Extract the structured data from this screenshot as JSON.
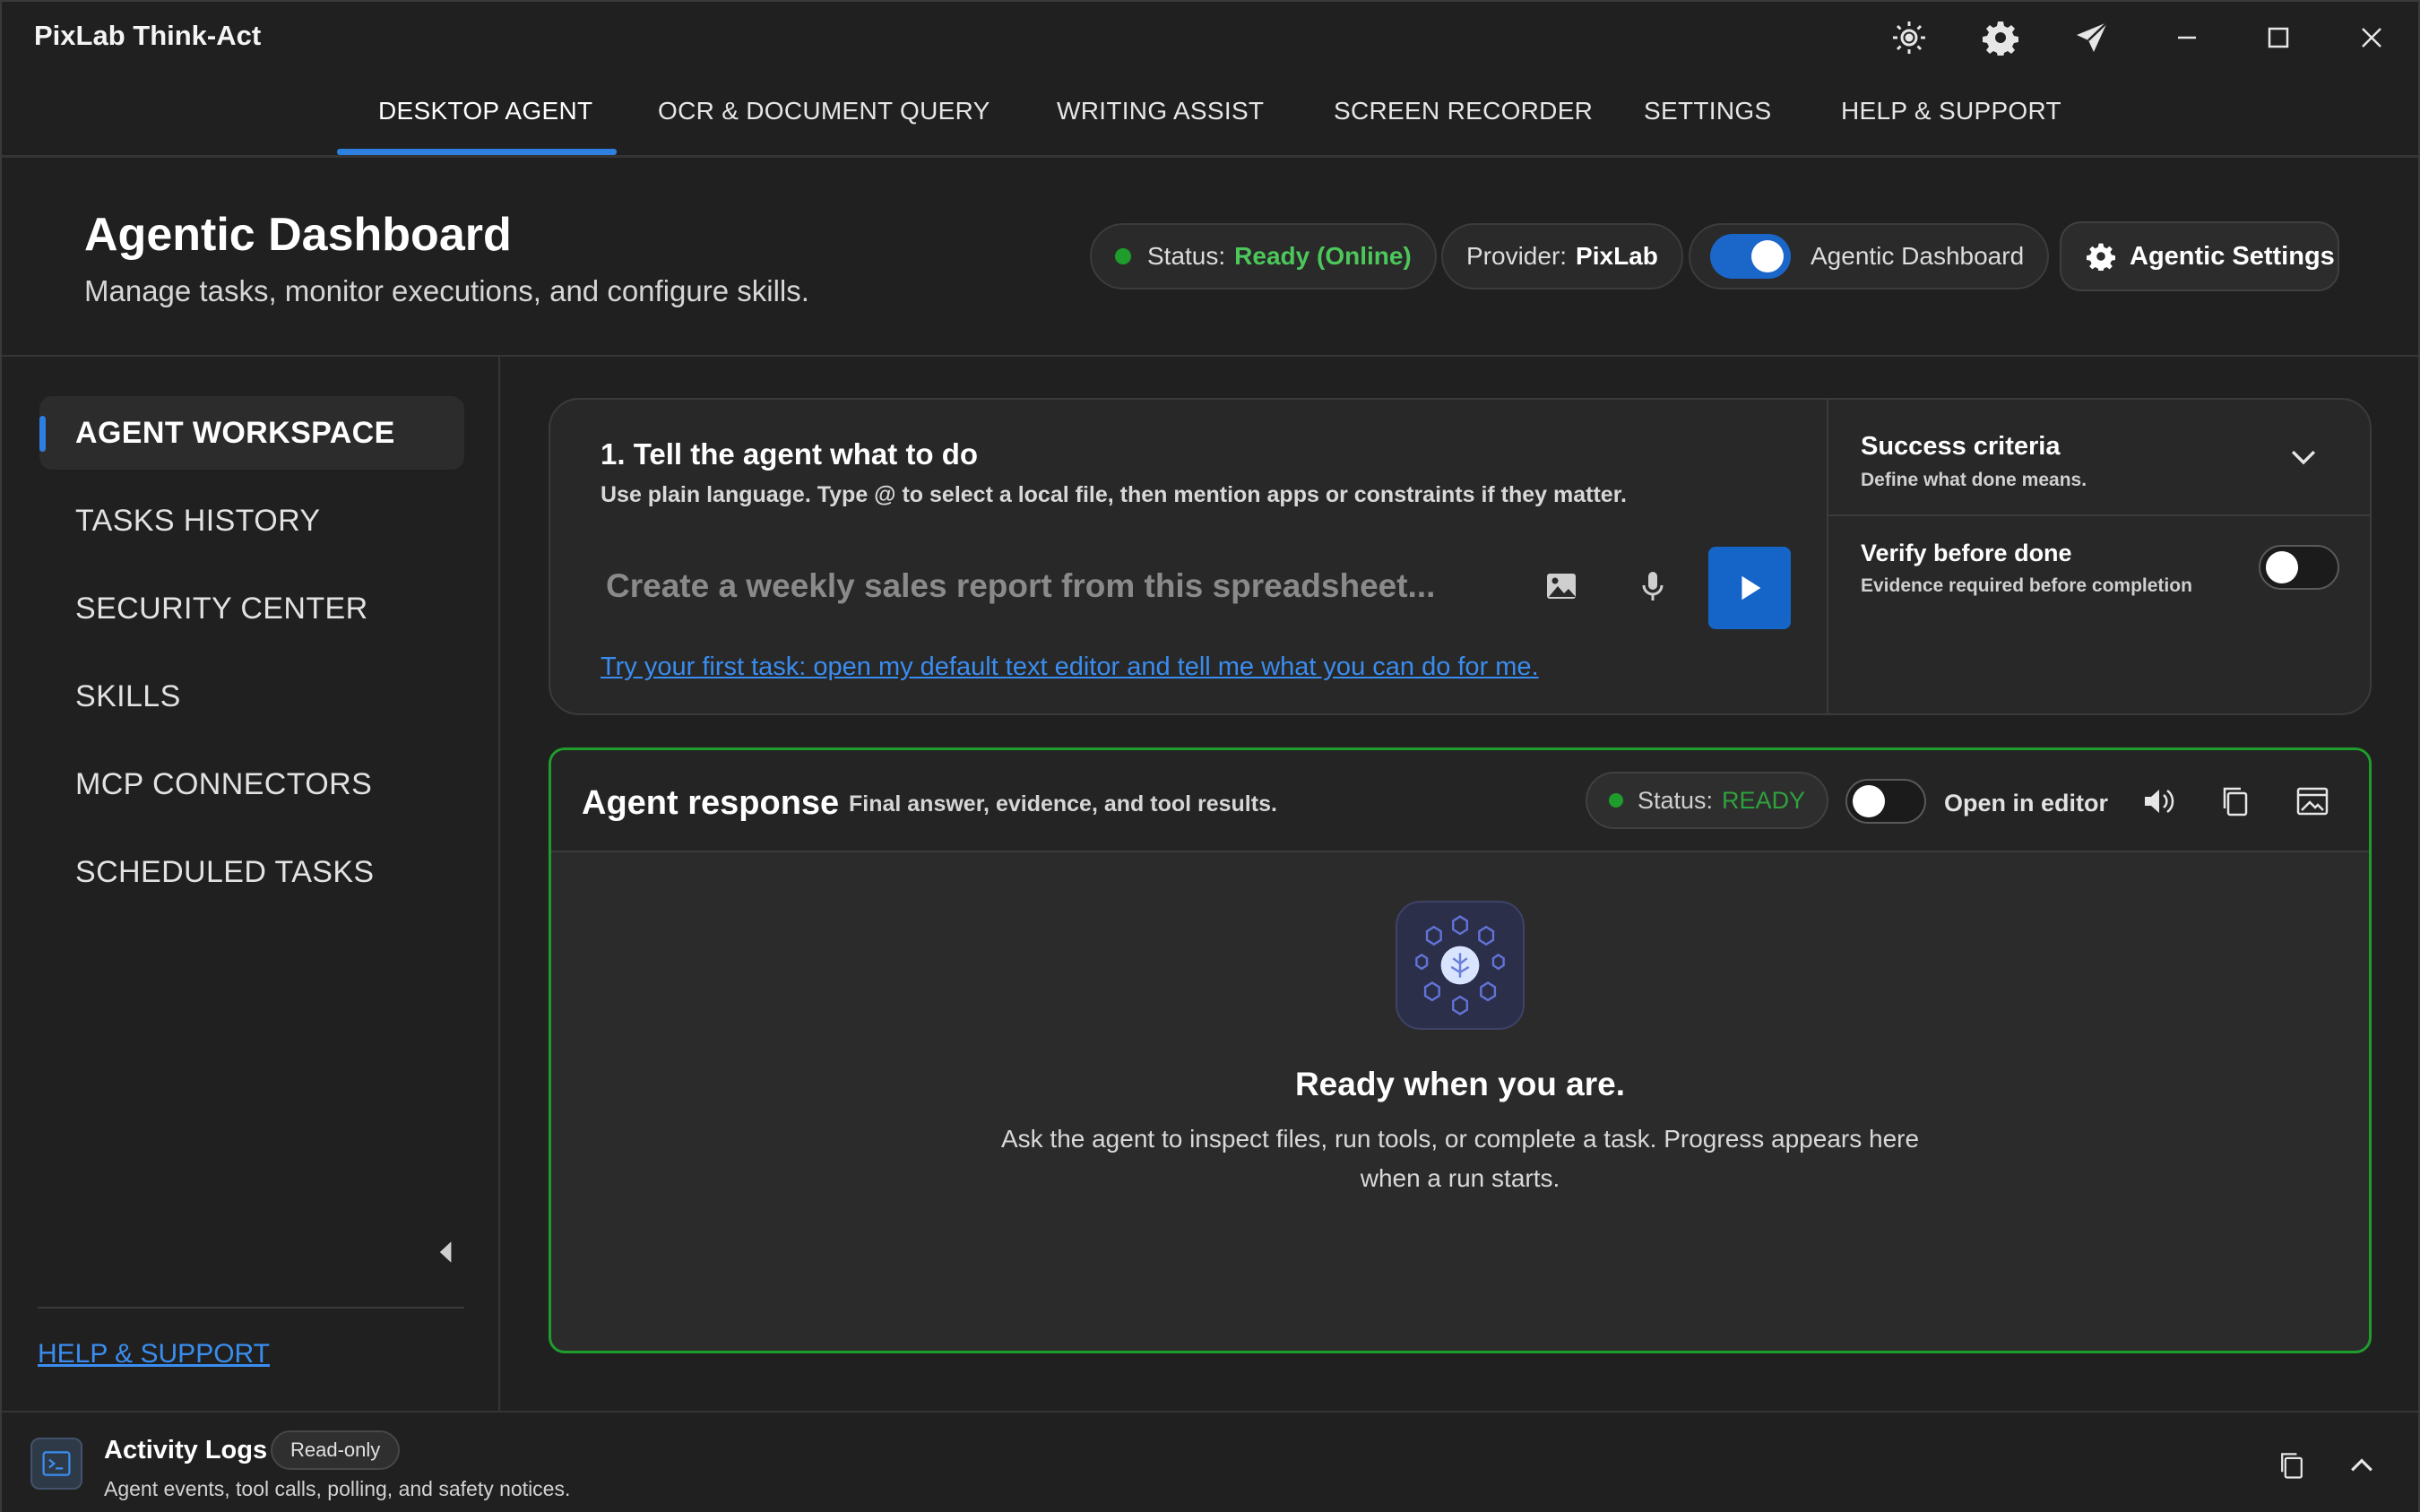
{
  "app": {
    "title": "PixLab Think-Act"
  },
  "titlebar": {
    "icons": [
      "theme-icon",
      "gear-icon",
      "send-icon",
      "minimize-icon",
      "maximize-icon",
      "close-icon"
    ]
  },
  "nav": {
    "tabs": [
      {
        "label": "DESKTOP AGENT",
        "active": true
      },
      {
        "label": "OCR & DOCUMENT QUERY"
      },
      {
        "label": "WRITING ASSIST"
      },
      {
        "label": "SCREEN RECORDER"
      },
      {
        "label": "SETTINGS"
      },
      {
        "label": "HELP & SUPPORT"
      }
    ]
  },
  "header": {
    "title": "Agentic Dashboard",
    "subtitle": "Manage tasks, monitor executions, and configure skills.",
    "status_label": "Status:",
    "status_value": "Ready (Online)",
    "provider_label": "Provider:",
    "provider_value": "PixLab",
    "dashboard_toggle_label": "Agentic Dashboard",
    "dashboard_toggle_on": true,
    "settings_button": "Agentic Settings"
  },
  "sidebar": {
    "items": [
      {
        "label": "AGENT WORKSPACE",
        "active": true
      },
      {
        "label": "TASKS HISTORY"
      },
      {
        "label": "SECURITY CENTER"
      },
      {
        "label": "SKILLS"
      },
      {
        "label": "MCP CONNECTORS"
      },
      {
        "label": "SCHEDULED TASKS"
      }
    ],
    "help_link": "HELP & SUPPORT"
  },
  "task": {
    "heading": "1. Tell the agent what to do",
    "subheading": "Use plain language. Type @ to select a local file, then mention apps or constraints if they matter.",
    "input_placeholder": "Create a weekly sales report from this spreadsheet...",
    "first_task_link": "Try your first task: open my default text editor and tell me what you can do for me.",
    "criteria_title": "Success criteria",
    "criteria_sub": "Define what done means.",
    "verify_title": "Verify before done",
    "verify_sub": "Evidence required before completion",
    "verify_on": false
  },
  "response": {
    "title": "Agent response",
    "subtitle": "Final answer, evidence, and tool results.",
    "status_label": "Status:",
    "status_value": "READY",
    "open_in_editor": "Open in editor",
    "open_in_editor_on": false,
    "empty_title": "Ready when you are.",
    "empty_text": "Ask the agent to inspect files, run tools, or complete a task. Progress appears here when a run starts."
  },
  "activity": {
    "title": "Activity Logs",
    "badge": "Read-only",
    "subtitle": "Agent events, tool calls, polling, and safety notices."
  },
  "colors": {
    "accent": "#2d7fe0",
    "run_button": "#1565c8",
    "status_green": "#4cc75a",
    "panel_border_green": "#1f9d2c",
    "link": "#3a8df0"
  }
}
